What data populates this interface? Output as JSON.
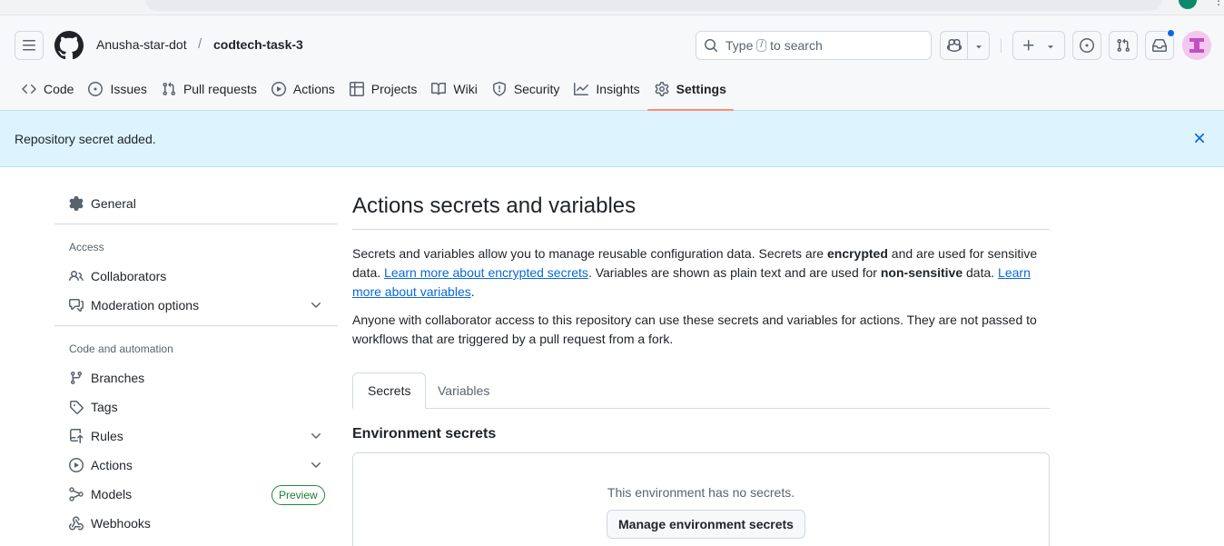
{
  "breadcrumb": {
    "owner": "Anusha-star-dot",
    "separator": "/",
    "repo": "codtech-task-3"
  },
  "search": {
    "prefix": "Type",
    "key": "/",
    "suffix": "to search"
  },
  "nav": {
    "code": "Code",
    "issues": "Issues",
    "pull_requests": "Pull requests",
    "actions": "Actions",
    "projects": "Projects",
    "wiki": "Wiki",
    "security": "Security",
    "insights": "Insights",
    "settings": "Settings",
    "active": "Settings"
  },
  "flash": {
    "message": "Repository secret added."
  },
  "sidebar": {
    "general": "General",
    "access_heading": "Access",
    "collaborators": "Collaborators",
    "moderation": "Moderation options",
    "code_heading": "Code and automation",
    "branches": "Branches",
    "tags": "Tags",
    "rules": "Rules",
    "actions": "Actions",
    "models": "Models",
    "models_badge": "Preview",
    "webhooks": "Webhooks"
  },
  "main": {
    "title": "Actions secrets and variables",
    "p1_a": "Secrets and variables allow you to manage reusable configuration data. Secrets are ",
    "p1_b": "encrypted",
    "p1_c": " and are used for sensitive data. ",
    "p1_link1": "Learn more about encrypted secrets",
    "p1_d": ". Variables are shown as plain text and are used for ",
    "p1_e": "non-sensitive",
    "p1_f": " data. ",
    "p1_link2": "Learn more about variables",
    "p1_g": ".",
    "p2": "Anyone with collaborator access to this repository can use these secrets and variables for actions. They are not passed to workflows that are triggered by a pull request from a fork.",
    "tabs": {
      "secrets": "Secrets",
      "variables": "Variables",
      "selected": "Secrets"
    },
    "env_title": "Environment secrets",
    "empty_text": "This environment has no secrets.",
    "manage_button": "Manage environment secrets"
  },
  "colors": {
    "flash_bg": "#ddf4ff",
    "link": "#0969da",
    "active_tab_underline": "#fd8c73",
    "badge_green": "#1a7f37",
    "notification_dot": "#0969da"
  }
}
